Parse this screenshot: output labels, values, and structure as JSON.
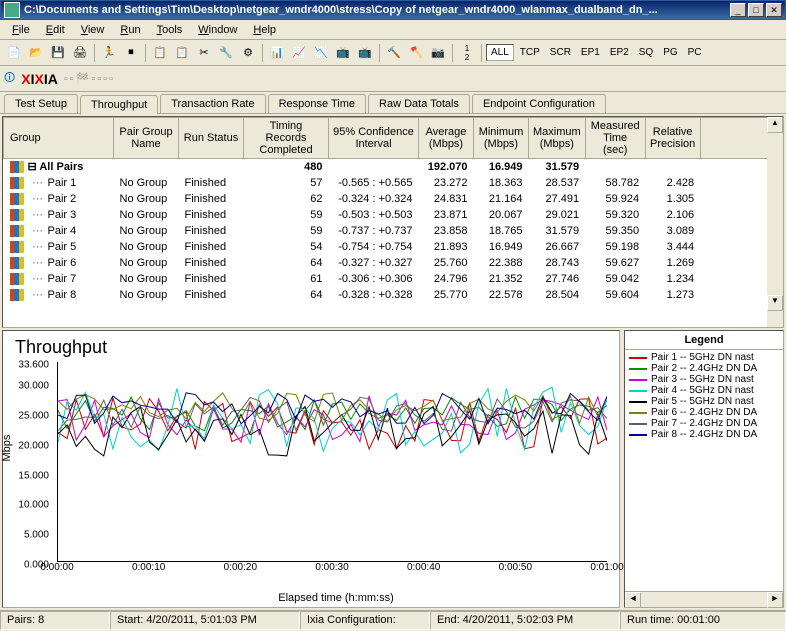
{
  "window": {
    "title": "C:\\Documents and Settings\\Tim\\Desktop\\netgear_wndr4000\\stress\\Copy of netgear_wndr4000_wlanmax_dualband_dn_..."
  },
  "menu": [
    "File",
    "Edit",
    "View",
    "Run",
    "Tools",
    "Window",
    "Help"
  ],
  "toolbar_text": [
    "ALL",
    "TCP",
    "SCR",
    "EP1",
    "EP2",
    "SQ",
    "PG",
    "PC"
  ],
  "tabs": [
    "Test Setup",
    "Throughput",
    "Transaction Rate",
    "Response Time",
    "Raw Data Totals",
    "Endpoint Configuration"
  ],
  "active_tab": 1,
  "table": {
    "headers": [
      "Group",
      "Pair Group Name",
      "Run Status",
      "Timing Records Completed",
      "95% Confidence Interval",
      "Average (Mbps)",
      "Minimum (Mbps)",
      "Maximum (Mbps)",
      "Measured Time (sec)",
      "Relative Precision"
    ],
    "all_pairs_label": "All Pairs",
    "all_pairs": {
      "completed": "480",
      "avg": "192.070",
      "min": "16.949",
      "max": "31.579"
    },
    "rows": [
      {
        "pair": "Pair 1",
        "group": "No Group",
        "status": "Finished",
        "completed": "57",
        "ci": "-0.565 : +0.565",
        "avg": "23.272",
        "min": "18.363",
        "max": "28.537",
        "time": "58.782",
        "prec": "2.428"
      },
      {
        "pair": "Pair 2",
        "group": "No Group",
        "status": "Finished",
        "completed": "62",
        "ci": "-0.324 : +0.324",
        "avg": "24.831",
        "min": "21.164",
        "max": "27.491",
        "time": "59.924",
        "prec": "1.305"
      },
      {
        "pair": "Pair 3",
        "group": "No Group",
        "status": "Finished",
        "completed": "59",
        "ci": "-0.503 : +0.503",
        "avg": "23.871",
        "min": "20.067",
        "max": "29.021",
        "time": "59.320",
        "prec": "2.106"
      },
      {
        "pair": "Pair 4",
        "group": "No Group",
        "status": "Finished",
        "completed": "59",
        "ci": "-0.737 : +0.737",
        "avg": "23.858",
        "min": "18.765",
        "max": "31.579",
        "time": "59.350",
        "prec": "3.089"
      },
      {
        "pair": "Pair 5",
        "group": "No Group",
        "status": "Finished",
        "completed": "54",
        "ci": "-0.754 : +0.754",
        "avg": "21.893",
        "min": "16.949",
        "max": "26.667",
        "time": "59.198",
        "prec": "3.444"
      },
      {
        "pair": "Pair 6",
        "group": "No Group",
        "status": "Finished",
        "completed": "64",
        "ci": "-0.327 : +0.327",
        "avg": "25.760",
        "min": "22.388",
        "max": "28.743",
        "time": "59.627",
        "prec": "1.269"
      },
      {
        "pair": "Pair 7",
        "group": "No Group",
        "status": "Finished",
        "completed": "61",
        "ci": "-0.306 : +0.306",
        "avg": "24.796",
        "min": "21.352",
        "max": "27.746",
        "time": "59.042",
        "prec": "1.234"
      },
      {
        "pair": "Pair 8",
        "group": "No Group",
        "status": "Finished",
        "completed": "64",
        "ci": "-0.328 : +0.328",
        "avg": "25.770",
        "min": "22.578",
        "max": "28.504",
        "time": "59.604",
        "prec": "1.273"
      }
    ]
  },
  "chart_data": {
    "type": "line",
    "title": "Throughput",
    "ylabel": "Mbps",
    "xlabel": "Elapsed time (h:mm:ss)",
    "ylim": [
      0,
      33.6
    ],
    "y_ticks": [
      "0.000",
      "5.000",
      "10.000",
      "15.000",
      "20.000",
      "25.000",
      "30.000",
      "33.600"
    ],
    "x_ticks": [
      "0:00:00",
      "0:00:10",
      "0:00:20",
      "0:00:30",
      "0:00:40",
      "0:00:50",
      "0:01:00"
    ],
    "series": [
      {
        "name": "Pair 1 -- 5GHz DN nast",
        "color": "#d00000"
      },
      {
        "name": "Pair 2 -- 2.4GHz DN DA",
        "color": "#009000"
      },
      {
        "name": "Pair 3 -- 5GHz DN nast",
        "color": "#d000d0"
      },
      {
        "name": "Pair 4 -- 5GHz DN nast",
        "color": "#00d0d0"
      },
      {
        "name": "Pair 5 -- 5GHz DN nast",
        "color": "#000000"
      },
      {
        "name": "Pair 6 -- 2.4GHz DN DA",
        "color": "#808000"
      },
      {
        "name": "Pair 7 -- 2.4GHz DN DA",
        "color": "#606060"
      },
      {
        "name": "Pair 8 -- 2.4GHz DN DA",
        "color": "#000080"
      }
    ]
  },
  "legend_title": "Legend",
  "status": {
    "pairs": "Pairs: 8",
    "start": "Start: 4/20/2011, 5:01:03 PM",
    "ixia": "Ixia Configuration:",
    "end": "End: 4/20/2011, 5:02:03 PM",
    "runtime": "Run time: 00:01:00"
  }
}
